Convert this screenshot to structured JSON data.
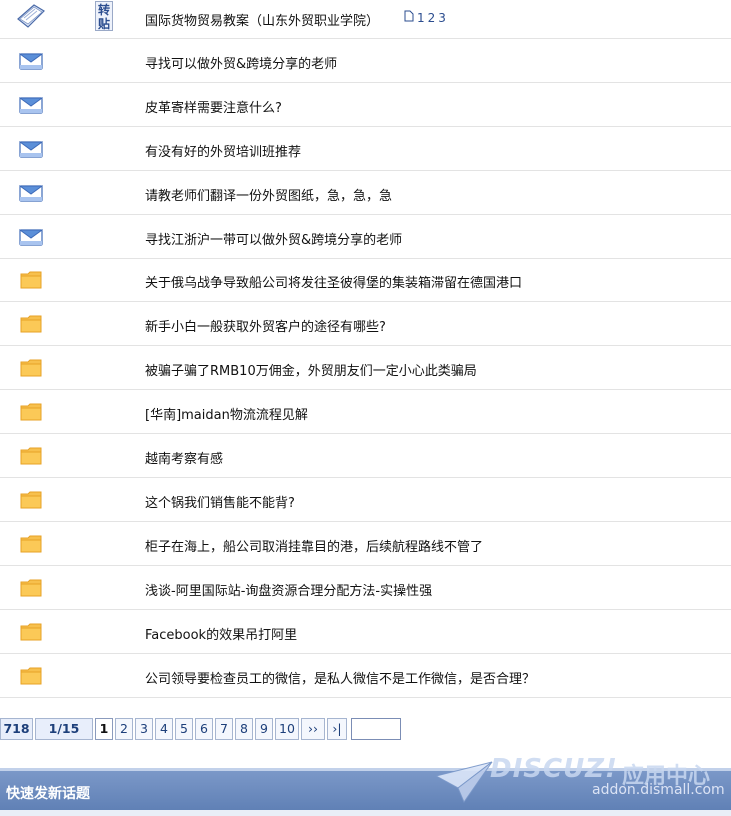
{
  "threads": [
    {
      "icon": "book-icon",
      "badge": "转贴",
      "title": "国际货物贸易教案（山东外贸职业学院）",
      "pages": [
        "1",
        "2",
        "3"
      ]
    },
    {
      "icon": "mail-icon",
      "title": "寻找可以做外贸&跨境分享的老师"
    },
    {
      "icon": "mail-icon",
      "title": "皮革寄样需要注意什么?"
    },
    {
      "icon": "mail-icon",
      "title": "有没有好的外贸培训班推荐"
    },
    {
      "icon": "mail-icon",
      "title": "请教老师们翻译一份外贸图纸，急，急，急"
    },
    {
      "icon": "mail-icon",
      "title": "寻找江浙沪一带可以做外贸&跨境分享的老师"
    },
    {
      "icon": "folder-icon",
      "title": "关于俄乌战争导致船公司将发往圣彼得堡的集装箱滞留在德国港口"
    },
    {
      "icon": "folder-icon",
      "title": "新手小白一般获取外贸客户的途径有哪些?"
    },
    {
      "icon": "folder-icon",
      "title": "被骗子骗了RMB10万佣金，外贸朋友们一定小心此类骗局"
    },
    {
      "icon": "folder-icon",
      "title": "[华南]maidan物流流程见解"
    },
    {
      "icon": "folder-icon",
      "title": "越南考察有感"
    },
    {
      "icon": "folder-icon",
      "title": "这个锅我们销售能不能背?"
    },
    {
      "icon": "folder-icon",
      "title": "柜子在海上，船公司取消挂靠目的港，后续航程路线不管了"
    },
    {
      "icon": "folder-icon",
      "title": "浅谈-阿里国际站-询盘资源合理分配方法-实操性强"
    },
    {
      "icon": "folder-icon",
      "title": "Facebook的效果吊打阿里"
    },
    {
      "icon": "folder-icon",
      "title": "公司领导要检查员工的微信，是私人微信不是工作微信，是否合理？"
    }
  ],
  "pagination": {
    "total": "718",
    "page_of": "1/15",
    "pages": [
      "1",
      "2",
      "3",
      "4",
      "5",
      "6",
      "7",
      "8",
      "9",
      "10"
    ],
    "next": "››",
    "last": "›|",
    "jump_value": ""
  },
  "footer": {
    "title": "快速发新话题"
  },
  "watermark": {
    "brand": "DISCUZ!",
    "cn": "应用中心",
    "url": "addon.dismall.com"
  },
  "colors": {
    "accent": "#2b4d8f",
    "bar": "#6b8bc0",
    "folder": "#f5b53c"
  }
}
